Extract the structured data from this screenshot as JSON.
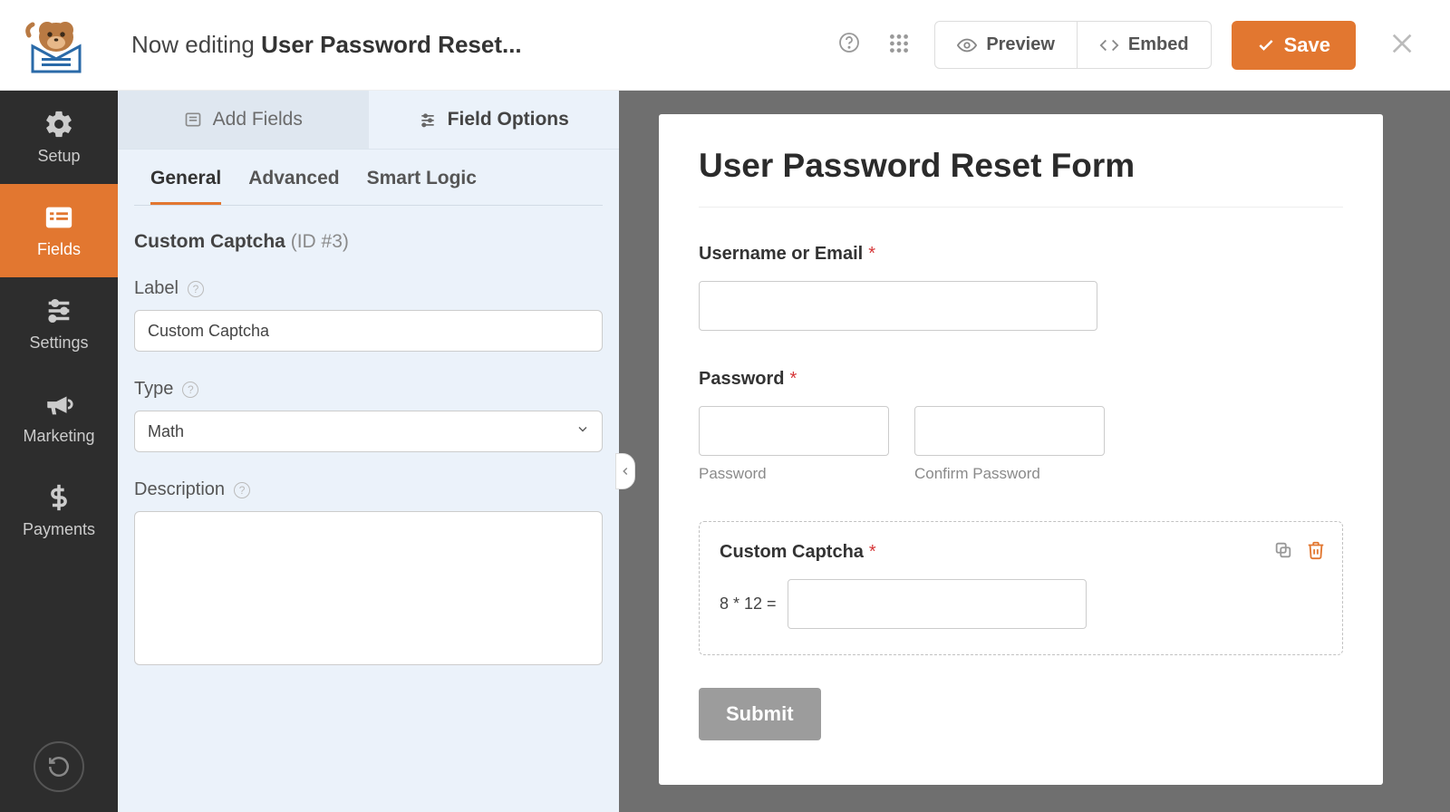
{
  "topbar": {
    "editing_prefix": "Now editing ",
    "editing_title": "User Password Reset...",
    "preview_label": "Preview",
    "embed_label": "Embed",
    "save_label": "Save"
  },
  "leftnav": {
    "items": [
      {
        "label": "Setup"
      },
      {
        "label": "Fields"
      },
      {
        "label": "Settings"
      },
      {
        "label": "Marketing"
      },
      {
        "label": "Payments"
      }
    ]
  },
  "sidebar": {
    "tabs": {
      "add_fields": "Add Fields",
      "field_options": "Field Options"
    },
    "subtabs": {
      "general": "General",
      "advanced": "Advanced",
      "smart_logic": "Smart Logic"
    },
    "field_name": "Custom Captcha",
    "field_id": "(ID #3)",
    "label_label": "Label",
    "label_value": "Custom Captcha",
    "type_label": "Type",
    "type_value": "Math",
    "description_label": "Description",
    "description_value": ""
  },
  "preview": {
    "form_title": "User Password Reset Form",
    "username_label": "Username or Email",
    "password_label": "Password",
    "password_sub": "Password",
    "confirm_sub": "Confirm Password",
    "captcha_label": "Custom Captcha",
    "captcha_equation": "8 * 12 =",
    "submit_label": "Submit"
  }
}
